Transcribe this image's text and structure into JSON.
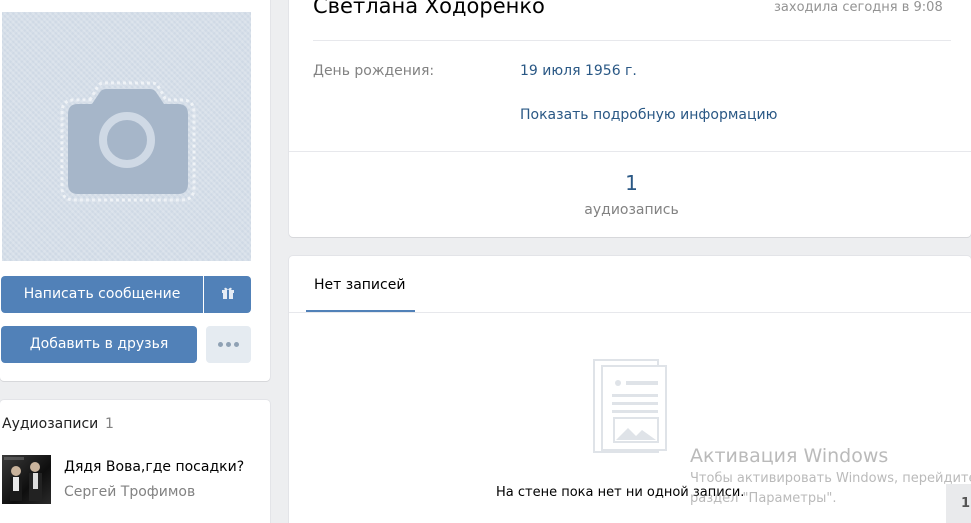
{
  "profile": {
    "name": "Светлана Ходоренко",
    "last_seen": "заходила сегодня в 9:08",
    "birthday_label": "День рождения:",
    "birthday_value": "19 июля 1956 г.",
    "more_info_link": "Показать подробную информацию"
  },
  "counters": {
    "audio_count": "1",
    "audio_label": "аудиозапись"
  },
  "actions": {
    "message_button": "Написать сообщение",
    "add_friend_button": "Добавить в друзья",
    "gift_icon": "gift-icon",
    "more_icon": "more-dots-icon"
  },
  "photo": {
    "placeholder_icon": "camera-icon"
  },
  "audio_block": {
    "title": "Аудиозаписи",
    "count": "1",
    "track": {
      "song": "Дядя Вова,где посадки?",
      "artist": "Сергей Трофимов"
    }
  },
  "wall": {
    "tab_label": "Нет записей",
    "empty_text": "На стене пока нет ни одной записи.",
    "empty_icon": "empty-wall-icon"
  },
  "watermark": {
    "title": "Активация Windows",
    "line1": "Чтобы активировать Windows, перейдите",
    "line2": "раздел \"Параметры\"."
  },
  "corner": {
    "text": "1"
  },
  "colors": {
    "accent": "#5181b8",
    "link": "#2a5885",
    "page_bg": "#edeef0"
  }
}
